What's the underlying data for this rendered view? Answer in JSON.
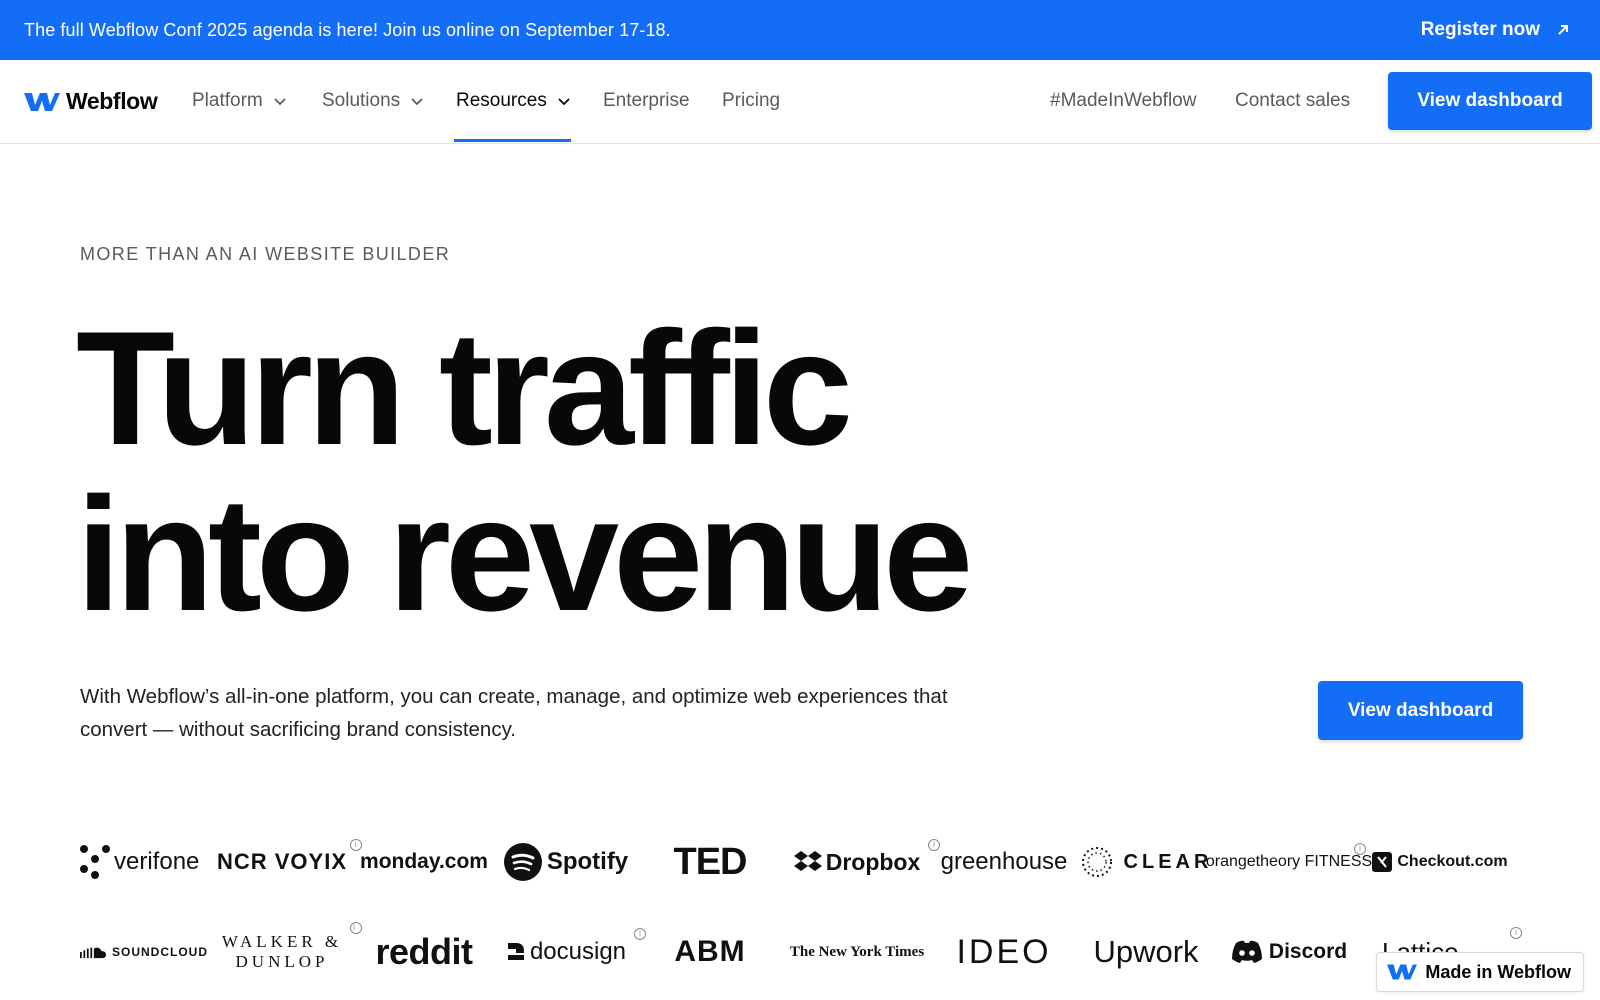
{
  "colors": {
    "brand_blue": "#146ef5",
    "text": "#080808",
    "muted": "#5a5a5a"
  },
  "banner": {
    "text": "The full Webflow Conf 2025 agenda is here! Join us online on September 17-18.",
    "link_label": "Register now",
    "link_icon": "arrow-up-right-icon"
  },
  "nav": {
    "logo_text": "Webflow",
    "items": [
      {
        "label": "Platform",
        "has_dropdown": true
      },
      {
        "label": "Solutions",
        "has_dropdown": true
      },
      {
        "label": "Resources",
        "has_dropdown": true,
        "active": true
      },
      {
        "label": "Enterprise",
        "has_dropdown": false
      },
      {
        "label": "Pricing",
        "has_dropdown": false
      }
    ],
    "right_links": [
      "#MadeInWebflow",
      "Contact sales"
    ],
    "cta": "View dashboard"
  },
  "hero": {
    "eyebrow": "MORE THAN AN AI WEBSITE BUILDER",
    "headline_line1": "Turn traffic",
    "headline_line2": "into revenue",
    "subtext": "With Webflow’s all-in-one platform, you can create, manage, and optimize web experiences that convert — without sacrificing brand consistency.",
    "cta": "View dashboard"
  },
  "logos": {
    "row1": [
      "verifone",
      "NCR VOYIX",
      "monday.com",
      "Spotify",
      "TED",
      "Dropbox",
      "greenhouse",
      "CLEAR",
      "orangetheory FITNESS",
      "Checkout.com"
    ],
    "row2": [
      "SOUNDCLOUD",
      "WALKER & DUNLOP",
      "reddit",
      "docusign",
      "ABM",
      "The New York Times",
      "IDEO",
      "Upwork",
      "Discord",
      "Lattice"
    ],
    "info_badge": "i"
  },
  "badge": {
    "label": "Made in Webflow"
  }
}
